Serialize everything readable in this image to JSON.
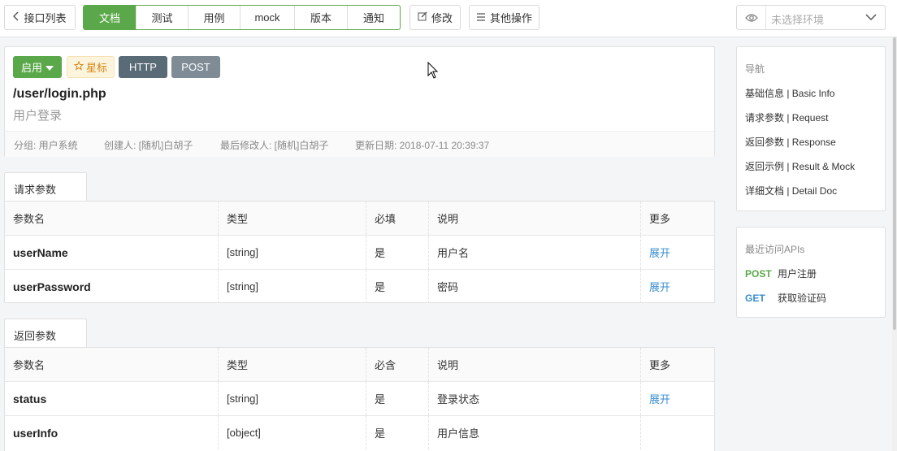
{
  "toolbar": {
    "back_label": "接口列表",
    "tabs": [
      {
        "label": "文档",
        "active": true
      },
      {
        "label": "测试",
        "active": false
      },
      {
        "label": "用例",
        "active": false
      },
      {
        "label": "mock",
        "active": false
      },
      {
        "label": "版本",
        "active": false
      },
      {
        "label": "通知",
        "active": false
      }
    ],
    "edit_label": "修改",
    "more_label": "其他操作",
    "env_placeholder": "未选择环境"
  },
  "api": {
    "status_label": "启用",
    "star_label": "星标",
    "protocol": "HTTP",
    "method": "POST",
    "path": "/user/login.php",
    "name": "用户登录",
    "group": "分组: 用户系统",
    "creator": "创建人: [随机]白胡子",
    "modifier": "最后修改人: [随机]白胡子",
    "updated": "更新日期: 2018-07-11 20:39:37"
  },
  "request": {
    "tab_label": "请求参数",
    "headers": [
      "参数名",
      "类型",
      "必填",
      "说明",
      "更多"
    ],
    "rows": [
      {
        "name": "userName",
        "type": "[string]",
        "required": "是",
        "desc": "用户名",
        "more": "展开"
      },
      {
        "name": "userPassword",
        "type": "[string]",
        "required": "是",
        "desc": "密码",
        "more": "展开"
      }
    ]
  },
  "response": {
    "tab_label": "返回参数",
    "headers": [
      "参数名",
      "类型",
      "必含",
      "说明",
      "更多"
    ],
    "rows": [
      {
        "name": "status",
        "type": "[string]",
        "required": "是",
        "desc": "登录状态",
        "more": "展开"
      },
      {
        "name": "userInfo",
        "type": "[object]",
        "required": "是",
        "desc": "用户信息",
        "more": ""
      }
    ]
  },
  "nav": {
    "title": "导航",
    "items": [
      "基础信息 | Basic Info",
      "请求参数 | Request",
      "返回参数 | Response",
      "返回示例 | Result & Mock",
      "详细文档 | Detail Doc"
    ]
  },
  "recent": {
    "title": "最近访问APIs",
    "items": [
      {
        "method": "POST",
        "name": "用户注册",
        "color": "#5aa84a"
      },
      {
        "method": "GET",
        "name": "获取验证码",
        "color": "#3a8ed0"
      }
    ]
  },
  "colors": {
    "primary": "#5aa84a",
    "link": "#3a8ed0"
  }
}
